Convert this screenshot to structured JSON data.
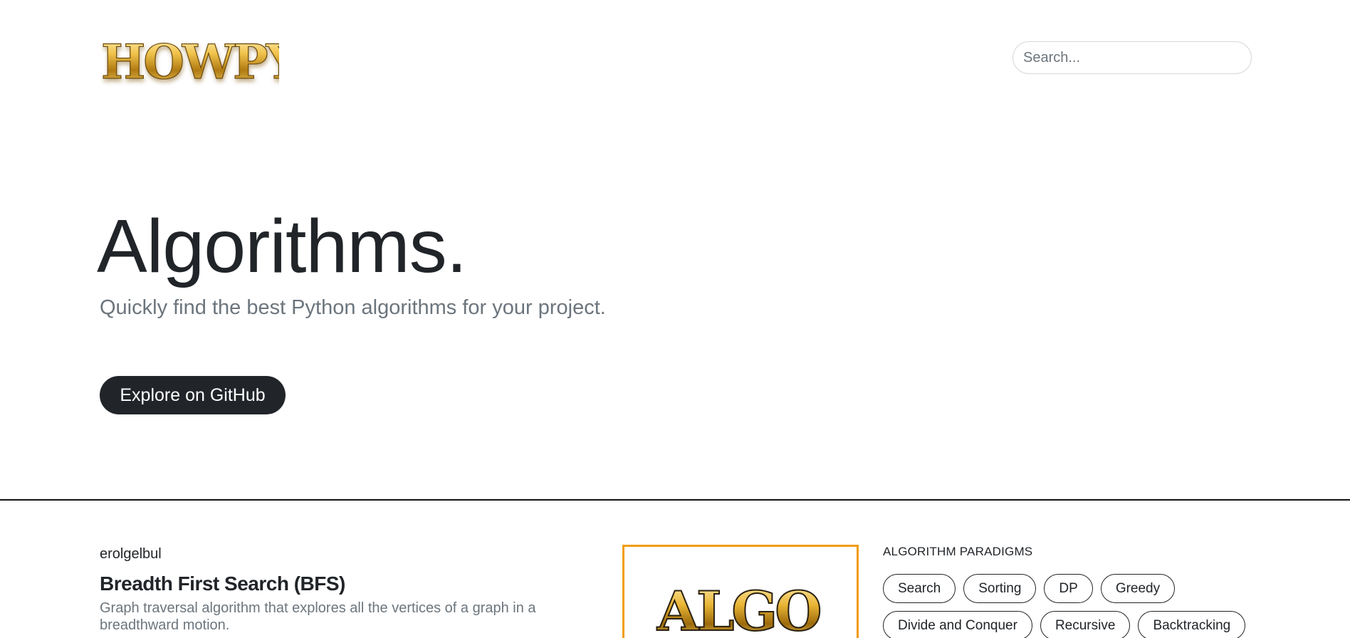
{
  "header": {
    "logo_text": "HOWPY",
    "search": {
      "placeholder": "Search..."
    }
  },
  "hero": {
    "title": "Algorithms.",
    "subtitle": "Quickly find the best Python algorithms for your project.",
    "cta_label": "Explore on GitHub"
  },
  "post": {
    "author": "erolgelbul",
    "title": "Breadth First Search (BFS)",
    "description": "Graph traversal algorithm that explores all the vertices of a graph in a breadthward motion.",
    "thumbnail_text": "ALGO"
  },
  "paradigms": {
    "heading": "ALGORITHM PARADIGMS",
    "tags": [
      "Search",
      "Sorting",
      "DP",
      "Greedy",
      "Divide and Conquer",
      "Recursive",
      "Backtracking"
    ]
  },
  "colors": {
    "primary_dark": "#212529",
    "muted_text": "#6c757d",
    "thumb_border": "#f39c12",
    "gold": "#d4a017"
  }
}
